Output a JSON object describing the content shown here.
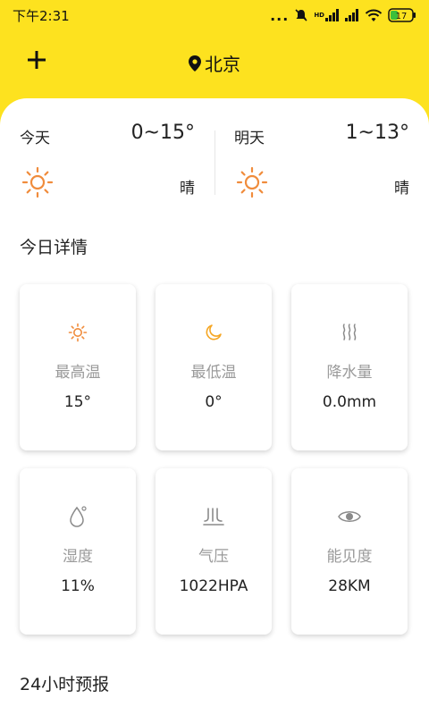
{
  "status_bar": {
    "time": "下午2:31",
    "dots": "...",
    "hd_label": "HD",
    "battery_level": "17"
  },
  "header": {
    "location": "北京"
  },
  "today": {
    "label": "今天",
    "temp": "0~15°",
    "condition": "晴",
    "icon": "sun-icon"
  },
  "tomorrow": {
    "label": "明天",
    "temp": "1~13°",
    "condition": "晴",
    "icon": "sun-icon"
  },
  "sections": {
    "details_title": "今日详情",
    "forecast_title": "24小时预报"
  },
  "details": [
    {
      "icon": "sun-icon",
      "label": "最高温",
      "value": "15°"
    },
    {
      "icon": "moon-icon",
      "label": "最低温",
      "value": "0°"
    },
    {
      "icon": "rain-icon",
      "label": "降水量",
      "value": "0.0mm"
    },
    {
      "icon": "droplet-icon",
      "label": "湿度",
      "value": "11%"
    },
    {
      "icon": "pressure-icon",
      "label": "气压",
      "value": "1022HPA"
    },
    {
      "icon": "eye-icon",
      "label": "能见度",
      "value": "28KM"
    }
  ],
  "colors": {
    "brand_yellow": "#fde21f",
    "sun_orange": "#f08c3c",
    "moon_orange": "#f5a623",
    "icon_gray": "#8a8a8a"
  }
}
